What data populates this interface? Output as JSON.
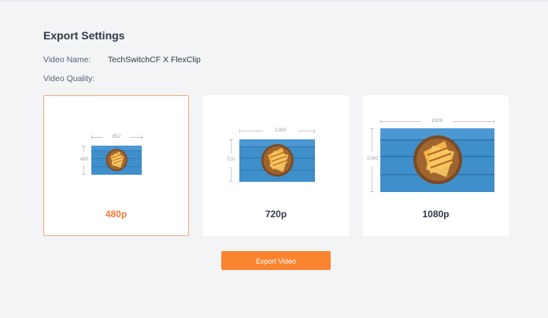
{
  "title": "Export Settings",
  "video_name": {
    "label": "Video Name:",
    "value": "TechSwitchCF X FlexClip"
  },
  "video_quality": {
    "label": "Video Quality:"
  },
  "options": [
    {
      "label": "480p",
      "width": "852",
      "height": "480",
      "selected": true
    },
    {
      "label": "720p",
      "width": "1280",
      "height": "720",
      "selected": false
    },
    {
      "label": "1080p",
      "width": "1920",
      "height": "1080",
      "selected": false
    }
  ],
  "export_button": {
    "label": "Export Video"
  },
  "colors": {
    "accent": "#fb8431",
    "selected_label": "#ef7a3a",
    "selected_border": "#f2a87a",
    "thumbnail_bg": "#3f8fcb"
  },
  "icons": {
    "thumbnail": "food-thumbnail-image"
  }
}
